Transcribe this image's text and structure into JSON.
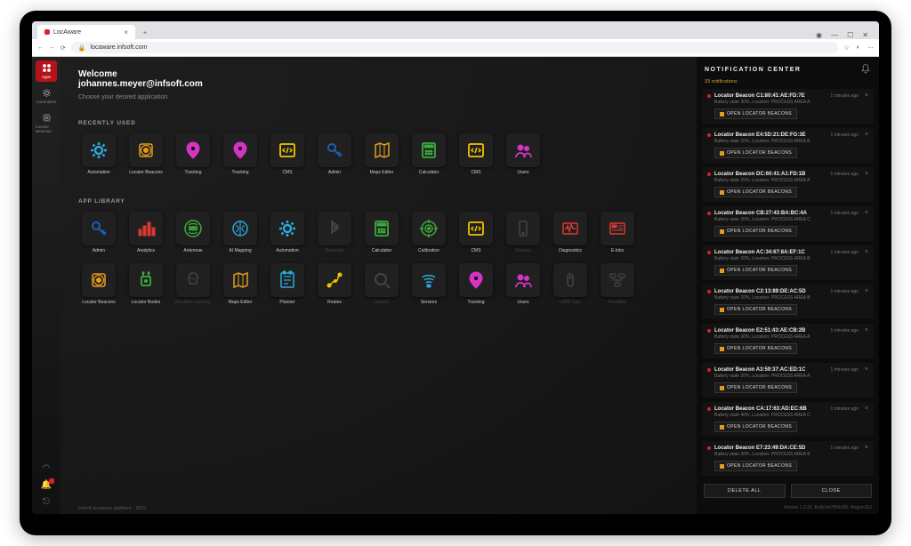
{
  "browser": {
    "tab_title": "LocAware",
    "url": "locaware.infsoft.com"
  },
  "sidebar": {
    "items": [
      {
        "label": "Apps",
        "icon": "apps",
        "active": true
      },
      {
        "label": "Automation",
        "icon": "gear",
        "active": false
      },
      {
        "label": "Locator Beacons",
        "icon": "beacon",
        "active": false
      }
    ]
  },
  "header": {
    "welcome": "Welcome",
    "email": "johannes.meyer@infsoft.com",
    "subtitle": "Choose your desired application:"
  },
  "sections": {
    "recent_title": "RECENTLY USED",
    "library_title": "APP LIBRARY"
  },
  "recent_apps": [
    {
      "label": "Automation",
      "icon": "gear",
      "color": "#2aa8d8"
    },
    {
      "label": "Locator Beacons",
      "icon": "beacon",
      "color": "#e39b1f"
    },
    {
      "label": "Tracking",
      "icon": "pin",
      "color": "#d633c3"
    },
    {
      "label": "Tracking",
      "icon": "pin",
      "color": "#d633c3"
    },
    {
      "label": "CMS",
      "icon": "cms",
      "color": "#f2c200"
    },
    {
      "label": "Admin",
      "icon": "key",
      "color": "#1e5fb3"
    },
    {
      "label": "Maps Editor",
      "icon": "map",
      "color": "#e39b1f"
    },
    {
      "label": "Calculator",
      "icon": "calc",
      "color": "#3caa3c"
    },
    {
      "label": "CMS",
      "icon": "cms",
      "color": "#f2c200"
    },
    {
      "label": "Users",
      "icon": "users",
      "color": "#d633c3"
    }
  ],
  "library_apps": [
    {
      "label": "Admin",
      "icon": "key",
      "color": "#1e5fb3"
    },
    {
      "label": "Analytics",
      "icon": "bars",
      "color": "#d83a2f"
    },
    {
      "label": "Antennas",
      "icon": "antenna",
      "color": "#3caa3c"
    },
    {
      "label": "AI Mapping",
      "icon": "brain",
      "color": "#2aa8d8"
    },
    {
      "label": "Automation",
      "icon": "gear",
      "color": "#2aa8d8"
    },
    {
      "label": "Bluetooth",
      "icon": "bt",
      "color": "#444",
      "dim": true
    },
    {
      "label": "Calculator",
      "icon": "calc",
      "color": "#3caa3c"
    },
    {
      "label": "Calibration",
      "icon": "calib",
      "color": "#3caa3c"
    },
    {
      "label": "CMS",
      "icon": "cms",
      "color": "#f2c200"
    },
    {
      "label": "Devices",
      "icon": "device",
      "color": "#444",
      "dim": true
    },
    {
      "label": "Diagnostics",
      "icon": "diag",
      "color": "#d83a2f"
    },
    {
      "label": "E-Inks",
      "icon": "eink",
      "color": "#d83a2f"
    },
    {
      "label": "Locator Beacons",
      "icon": "beacon",
      "color": "#e39b1f"
    },
    {
      "label": "Locator Nodes",
      "icon": "node",
      "color": "#3caa3c"
    },
    {
      "label": "Machine Learning",
      "icon": "ml",
      "color": "#444",
      "dim": true
    },
    {
      "label": "Maps Editor",
      "icon": "map",
      "color": "#e39b1f"
    },
    {
      "label": "Planner",
      "icon": "plan",
      "color": "#2aa8d8"
    },
    {
      "label": "Routes",
      "icon": "route",
      "color": "#f2c200"
    },
    {
      "label": "Search",
      "icon": "search",
      "color": "#444",
      "dim": true
    },
    {
      "label": "Sensors",
      "icon": "sensor",
      "color": "#2aa8d8"
    },
    {
      "label": "Tracking",
      "icon": "pin",
      "color": "#d633c3"
    },
    {
      "label": "Users",
      "icon": "users",
      "color": "#d633c3"
    },
    {
      "label": "UWB Tags",
      "icon": "uwb",
      "color": "#444",
      "dim": true
    },
    {
      "label": "Workflow",
      "icon": "flow",
      "color": "#444",
      "dim": true
    }
  ],
  "notifications": {
    "title": "NOTIFICATION CENTER",
    "count_label": "33 notifications",
    "button_label": "OPEN LOCATOR BEACONS",
    "delete_all": "DELETE ALL",
    "close": "CLOSE",
    "items": [
      {
        "title": "Locator Beacon C1:80:41:AE:FD:7E",
        "sub": "Battery state 30%, Location: PROCESS AREA A",
        "time": "1 minutes ago"
      },
      {
        "title": "Locator Beacon E4:5D:21:DE:FG:3E",
        "sub": "Battery state 20%, Location: PROCESS AREA B",
        "time": "1 minutes ago"
      },
      {
        "title": "Locator Beacon DC:60:41:A1:FD:1B",
        "sub": "Battery state 20%, Location: PROCESS AREA A",
        "time": "1 minutes ago"
      },
      {
        "title": "Locator Beacon CB:27:43:BA:BC:4A",
        "sub": "Battery state 30%, Location: PROCESS AREA C",
        "time": "1 minutes ago"
      },
      {
        "title": "Locator Beacon AC:34:67:8A:EF:1C",
        "sub": "Battery state 20%, Location: PROCESS AREA B",
        "time": "1 minutes ago"
      },
      {
        "title": "Locator Beacon C2:13:89:DE:AC:5D",
        "sub": "Battery state 20%, Location: PROCESS AREA B",
        "time": "1 minutes ago"
      },
      {
        "title": "Locator Beacon E2:51:43:AE:CB:2B",
        "sub": "Battery state 30%, Location: PROCESS AREA A",
        "time": "1 minutes ago"
      },
      {
        "title": "Locator Beacon A3:59:37:AC:ED:1C",
        "sub": "Battery state 20%, Location: PROCESS AREA A",
        "time": "1 minutes ago"
      },
      {
        "title": "Locator Beacon CA:17:63:AD:EC:6B",
        "sub": "Battery state 40%, Location: PROCESS AREA C",
        "time": "1 minutes ago"
      },
      {
        "title": "Locator Beacon E7:23:49:DA:CE:5D",
        "sub": "Battery state 30%, Location: PROCESS AREA B",
        "time": "1 minutes ago"
      }
    ]
  },
  "footer": {
    "left": "infsoft locaware platform · 2021",
    "right": "Version 1.2.32, Build bd7894d30, Region EU"
  },
  "icons_svg": {
    "apps": "<rect x='3' y='3' width='6' height='6' rx='1'/><rect x='13' y='3' width='6' height='6' rx='1'/><rect x='3' y='13' width='6' height='6' rx='1'/><rect x='13' y='13' width='6' height='6' rx='1'/>",
    "gear": "<circle cx='11' cy='11' r='4' fill='none' stroke-width='2.5'/><path d='M11 2v3M11 17v3M2 11h3M17 11h3M4.5 4.5l2 2M15.5 15.5l2 2M4.5 17.5l2-2M15.5 6.5l2-2' stroke-width='2.5'/>",
    "beacon": "<rect x='4' y='4' width='14' height='14' rx='2' fill='none' stroke-width='1.5'/><circle cx='11' cy='11' r='2.5'/><circle cx='11' cy='11' r='5.5' fill='none' stroke-width='1.2'/>",
    "pin": "<path d='M11 2C7 2 4 5 4 9c0 5 7 11 7 11s7-6 7-11c0-4-3-7-7-7z'/><circle cx='11' cy='9' r='2.5' fill='#000'/>",
    "cms": "<rect x='3' y='4' width='16' height='14' rx='1.5' fill='none' stroke-width='1.8'/><path d='M8 9l-2 2 2 2M14 9l2 2-2 2M12 8l-2 6' stroke-width='1.5' fill='none'/>",
    "key": "<circle cx='8' cy='8' r='4' fill='none' stroke-width='2'/><path d='M11 11l7 7M15 15l2-2M17 17l2-2' stroke-width='2'/>",
    "map": "<path d='M4 5l5-2 5 2 5-2v14l-5 2-5-2-5 2z' fill='none' stroke-width='1.5'/><path d='M9 3v14M14 5v14' stroke-width='1'/>",
    "calc": "<rect x='4' y='3' width='14' height='16' rx='1.5' fill='none' stroke-width='1.8'/><rect x='6' y='5' width='10' height='3'/><circle cx='8' cy='12' r='1'/><circle cx='11' cy='12' r='1'/><circle cx='14' cy='12' r='1'/><circle cx='8' cy='15' r='1'/><circle cx='11' cy='15' r='1'/><circle cx='14' cy='15' r='1'/>",
    "users": "<circle cx='8' cy='8' r='3'/><circle cx='15' cy='9' r='2.5'/><path d='M3 19c0-3 2.5-5 5-5s5 2 5 5M12 19c0-2.5 1.5-4.5 4-4.5s4 2 4 4.5' fill='none' stroke-width='1.8'/>",
    "bars": "<rect x='3' y='12' width='3' height='7'/><rect x='8' y='8' width='3' height='11'/><rect x='13' y='4' width='3' height='15'/><rect x='18' y='10' width='3' height='9'/>",
    "antenna": "<circle cx='11' cy='11' r='9' fill='none' stroke-width='1.5'/><path d='M6 7c2-2 8-2 10 0M6 15c2 2 8 2 10 0' stroke-width='1.2' fill='none'/><text x='11' y='13' font-size='6' text-anchor='middle'>360</text>",
    "brain": "<circle cx='11' cy='11' r='8' fill='none' stroke-width='1.5'/><path d='M11 3v16M7 7c0 2 2 2 2 4s-2 2-2 4M15 7c0 2-2 2-2 4s2 2 2 4' fill='none' stroke-width='1.2'/>",
    "bt": "<path d='M8 6l7 5-7 5V3l7 5-7 5' fill='none' stroke-width='1.8'/>",
    "calib": "<circle cx='11' cy='11' r='8' fill='none' stroke-width='1.5'/><circle cx='11' cy='11' r='4' fill='none' stroke-width='1.5'/><circle cx='11' cy='11' r='1.5'/><path d='M11 1v4M11 17v4M1 11h4M17 11h4' stroke-width='1.5'/>",
    "device": "<rect x='7' y='3' width='8' height='16' rx='1.5' fill='none' stroke-width='1.5'/><circle cx='11' cy='16' r='1'/>",
    "diag": "<rect x='3' y='5' width='16' height='12' rx='1' fill='none' stroke-width='1.5'/><path d='M5 11h2l1-3 2 6 2-8 2 5h3' fill='none' stroke-width='1.5'/>",
    "eink": "<rect x='3' y='5' width='16' height='12' rx='1' fill='none' stroke-width='1.5'/><rect x='5' y='7' width='5' height='3'/><path d='M12 8h5M12 11h5M5 13h12' stroke-width='1'/>",
    "node": "<rect x='6' y='7' width='10' height='10' rx='1.5' fill='none' stroke-width='1.8'/><path d='M8 7V4M14 7V4M8 4c-1 0-1-2 0-2s1 2 0 2M14 4c-1 0-1-2 0-2s1 2 0 2' stroke-width='1.5'/><circle cx='11' cy='12' r='1.5'/>",
    "ml": "<path d='M11 3c-3 0-5 2-5 5 0 2 1 3 1 5v2h8v-2c0-2 1-3 1-5 0-3-2-5-5-5z' fill='none' stroke-width='1.5'/><path d='M8 8c1 0 1 2 3 2s2-2 3-2' fill='none' stroke-width='1'/>",
    "plan": "<rect x='4' y='3' width='14' height='16' rx='1' fill='none' stroke-width='1.5'/><path d='M7 7h8M7 11h8M7 15h5' stroke-width='1.2'/><rect x='6' y='1' width='3' height='3' rx='.5'/><rect x='13' y='1' width='3' height='3' rx='.5'/>",
    "route": "<circle cx='5' cy='17' r='2'/><circle cx='17' cy='5' r='2'/><circle cx='12' cy='12' r='1.5'/><path d='M6 16c3-1 2-4 6-4s2-5 4-6' fill='none' stroke-width='1.5'/>",
    "search": "<circle cx='10' cy='10' r='6' fill='none' stroke-width='2'/><path d='M15 15l5 5' stroke-width='2'/>",
    "sensor": "<path d='M4 8c2-3 12-3 14 0M6 11c1.5-2 8.5-2 10 0M8 14c1-1.5 5-1.5 6 0' fill='none' stroke-width='1.5'/><rect x='9' y='16' width='4' height='3' rx='.5'/>",
    "uwb": "<rect x='8' y='4' width='6' height='14' rx='3' fill='none' stroke-width='1.5'/><circle cx='11' cy='8' r='1'/>",
    "flow": "<rect x='3' y='4' width='6' height='4' rx='1' fill='none' stroke-width='1.3'/><rect x='13' y='4' width='6' height='4' rx='1' fill='none' stroke-width='1.3'/><rect x='8' y='14' width='6' height='4' rx='1' fill='none' stroke-width='1.3'/><path d='M6 8v3h10V8M11 11v3' stroke-width='1.2' fill='none'/>"
  }
}
